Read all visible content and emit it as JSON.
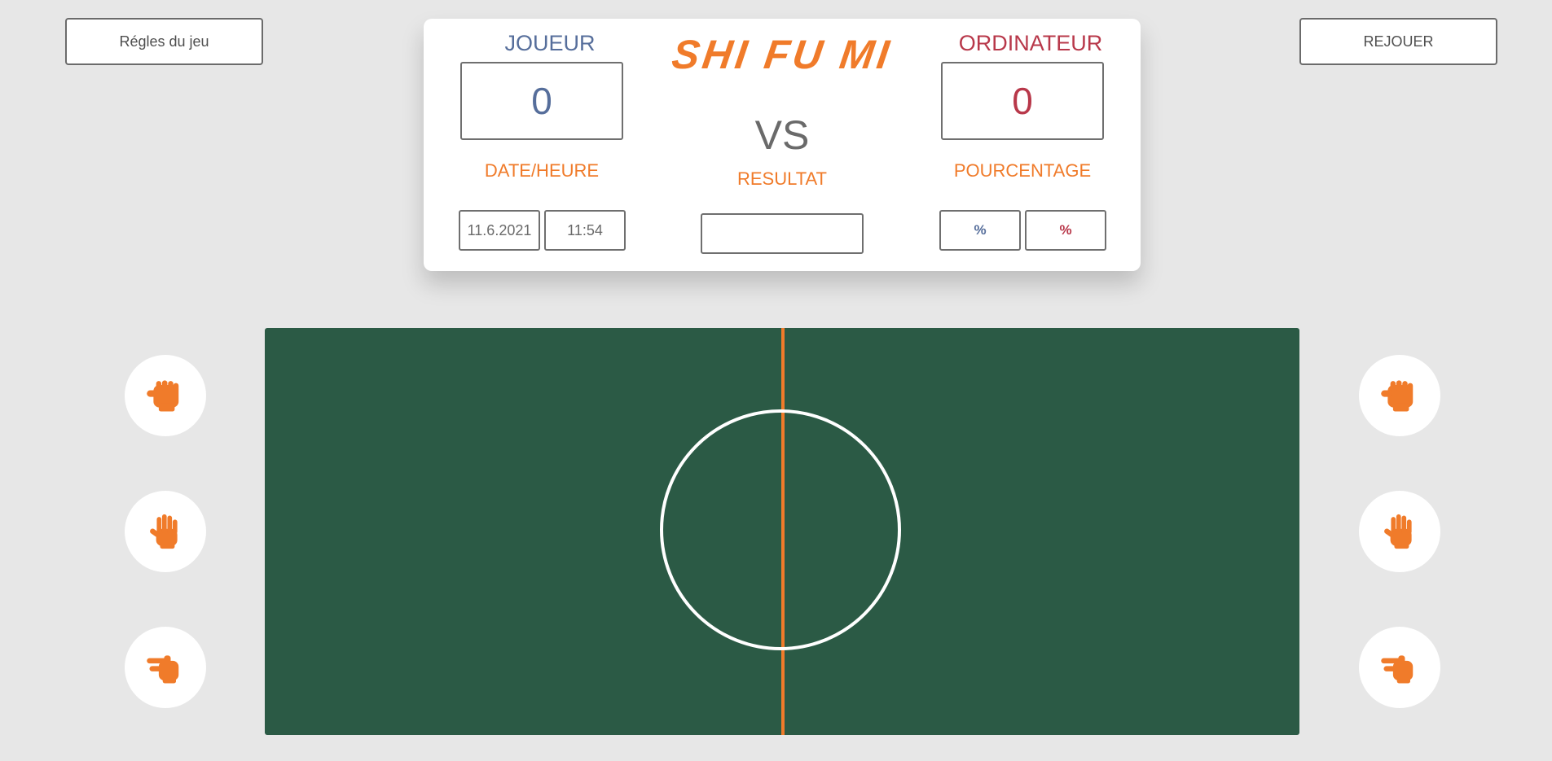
{
  "header": {
    "rules_button": "Régles du jeu",
    "replay_button": "REJOUER"
  },
  "scoreboard": {
    "title": "SHI FU MI",
    "vs": "VS",
    "player": {
      "name": "JOUEUR",
      "score": "0",
      "color": "#566e9b"
    },
    "computer": {
      "name": "ORDINATEUR",
      "score": "0",
      "color": "#b8384a"
    },
    "date_label": "DATE/HEURE",
    "date": "11.6.2021",
    "time": "11:54",
    "result_label": "RESULTAT",
    "result": "",
    "percent_label": "POURCENTAGE",
    "player_percent": "%",
    "computer_percent": "%",
    "accent_color": "#f07b2a"
  },
  "field": {
    "color": "#2b5a45",
    "line_color": "#f07b2a"
  },
  "choices": {
    "player": [
      "rock-icon",
      "paper-icon",
      "scissors-icon"
    ],
    "computer": [
      "rock-icon",
      "paper-icon",
      "scissors-icon"
    ]
  }
}
